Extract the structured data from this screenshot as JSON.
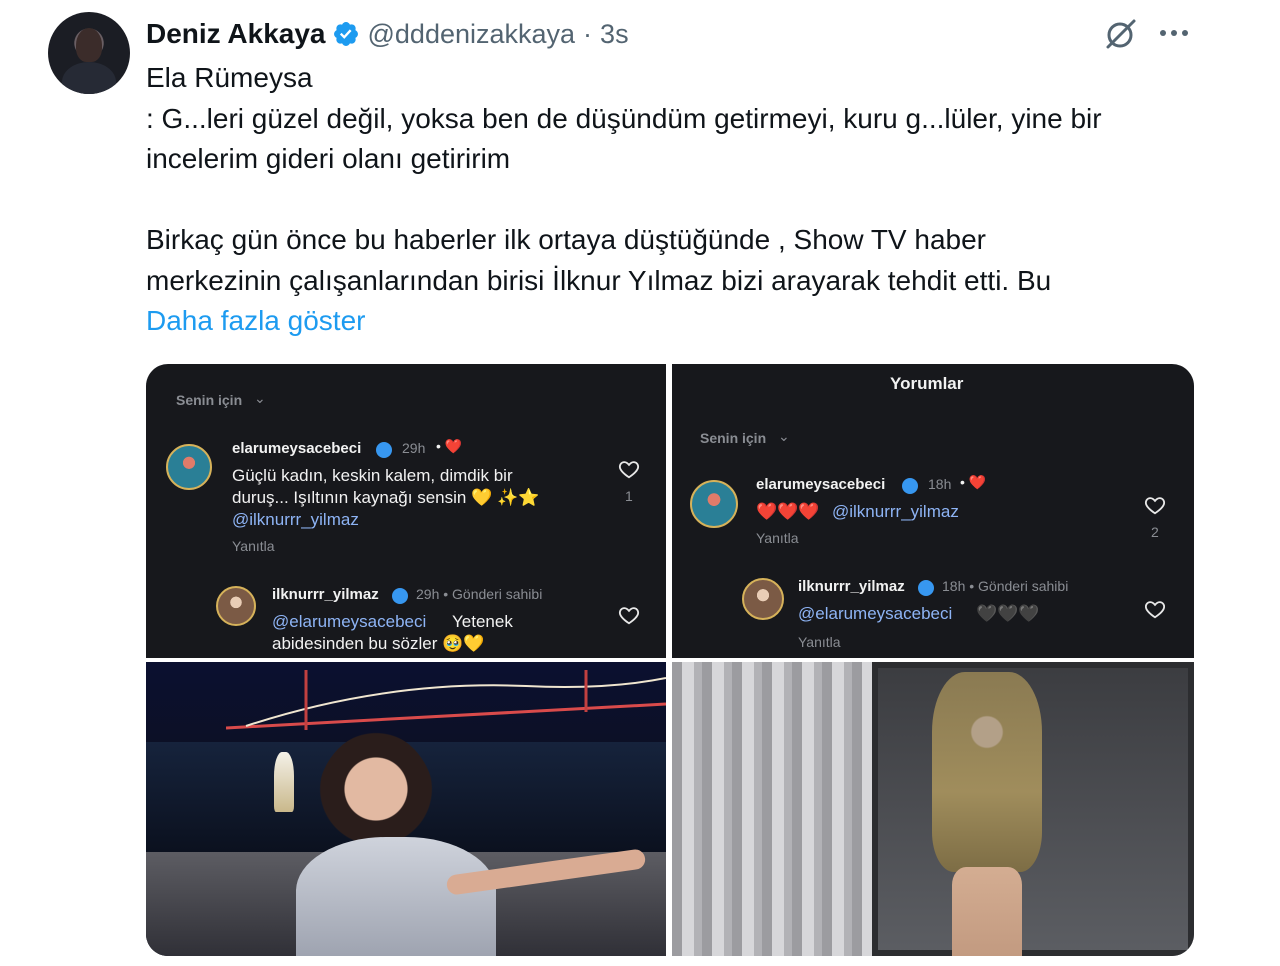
{
  "tweet": {
    "author_name": "Deniz Akkaya",
    "handle": "@dddenizakkaya",
    "separator": "·",
    "time": "3s",
    "lines": [
      "Ela Rümeysa",
      ": G...leri güzel değil, yoksa ben de düşündüm getirmeyi, kuru g...lüler, yine bir",
      "incelerim gideri olanı getiririm",
      "",
      "Birkaç gün önce bu haberler ilk ortaya düştüğünde , Show TV haber",
      "merkezinin çalışanlarından birisi İlknur Yılmaz bizi arayarak tehdit etti. Bu"
    ],
    "show_more": "Daha fazla göster",
    "icons": [
      "verified-badge-icon",
      "grok-icon",
      "more-icon"
    ],
    "accent_color": "#1d9bf0"
  },
  "media": {
    "screenshot_left": {
      "filter": "Senin için",
      "comment1": {
        "user": "elarumeysacebeci",
        "time": "29h",
        "text_line1": "Güçlü kadın, keskin kalem, dimdik bir",
        "text_line2": "duruş... Işıltının kaynağı sensin 💛 ✨⭐",
        "mention": "@ilknurrr_yilmaz",
        "reply": "Yanıtla",
        "likes": "1"
      },
      "comment2": {
        "user": "ilknurrr_yilmaz",
        "meta": "29h • Gönderi sahibi",
        "mention": "@elarumeysacebeci",
        "text_line1": "Yetenek",
        "text_line2": "abidesinden bu sözler 🥹💛"
      }
    },
    "screenshot_right": {
      "title": "Yorumlar",
      "filter": "Senin için",
      "comment1": {
        "user": "elarumeysacebeci",
        "time": "18h",
        "hearts": "❤️❤️❤️",
        "mention": "@ilknurrr_yilmaz",
        "reply": "Yanıtla",
        "likes": "2"
      },
      "comment2": {
        "user": "ilknurrr_yilmaz",
        "meta": "18h • Gönderi sahibi",
        "mention": "@elarumeysacebeci",
        "hearts": "🖤🖤🖤",
        "reply": "Yanıtla"
      }
    }
  }
}
